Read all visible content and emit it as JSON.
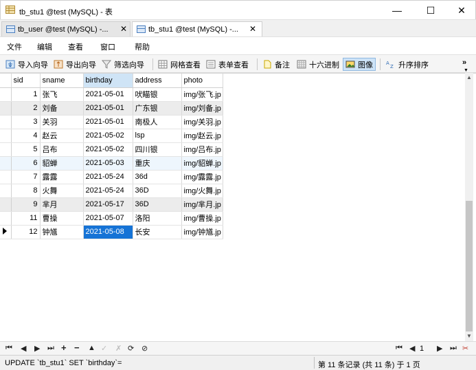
{
  "window": {
    "title": "tb_stu1 @test (MySQL) - 表",
    "controls": {
      "minimize": "—",
      "maximize": "☐",
      "close": "✕"
    }
  },
  "tabs": [
    {
      "label": "tb_user @test (MySQL) -...",
      "close": "✕",
      "active": false
    },
    {
      "label": "tb_stu1 @test (MySQL) -...",
      "close": "✕",
      "active": true
    }
  ],
  "menu": [
    "文件",
    "编辑",
    "查看",
    "窗口",
    "帮助"
  ],
  "toolbar": {
    "import_wizard": "导入向导",
    "export_wizard": "导出向导",
    "filter_wizard": "筛选向导",
    "grid_view": "网格查看",
    "form_view": "表单查看",
    "memo": "备注",
    "hex": "十六进制",
    "image": "图像",
    "sort_asc": "升序排序",
    "more": "»"
  },
  "grid": {
    "columns": [
      "sid",
      "sname",
      "birthday",
      "address",
      "photo"
    ],
    "selected_column": "birthday",
    "rows": [
      {
        "sid": "1",
        "sname": "张飞",
        "birthday": "2021-05-01",
        "address": "吠瞄银",
        "photo": "img/张飞.jp"
      },
      {
        "sid": "2",
        "sname": "刘备",
        "birthday": "2021-05-01",
        "address": "广东银",
        "photo": "img/刘备.jp"
      },
      {
        "sid": "3",
        "sname": "关羽",
        "birthday": "2021-05-01",
        "address": "南极人",
        "photo": "img/关羽.jp"
      },
      {
        "sid": "4",
        "sname": "赵云",
        "birthday": "2021-05-02",
        "address": "lsp",
        "photo": "img/赵云.jp"
      },
      {
        "sid": "5",
        "sname": "吕布",
        "birthday": "2021-05-02",
        "address": "四川银",
        "photo": "img/吕布.jp"
      },
      {
        "sid": "6",
        "sname": "貂蝉",
        "birthday": "2021-05-03",
        "address": "重庆",
        "photo": "img/貂蝉.jp"
      },
      {
        "sid": "7",
        "sname": "露露",
        "birthday": "2021-05-24",
        "address": "36d",
        "photo": "img/露露.jp"
      },
      {
        "sid": "8",
        "sname": "火舞",
        "birthday": "2021-05-24",
        "address": "36D",
        "photo": "img/火舞.jp"
      },
      {
        "sid": "9",
        "sname": "芈月",
        "birthday": "2021-05-17",
        "address": "36D",
        "photo": "img/芈月.jp"
      },
      {
        "sid": "11",
        "sname": "曹操",
        "birthday": "2021-05-07",
        "address": "洛阳",
        "photo": "img/曹操.jp"
      },
      {
        "sid": "12",
        "sname": "钟馗",
        "birthday": "2021-05-08",
        "address": "长安",
        "photo": "img/钟馗.jp"
      }
    ],
    "current_row_index": 10,
    "selected_cell": {
      "row": 10,
      "column": "birthday"
    }
  },
  "navigation": {
    "first": "⏮",
    "prev": "◀",
    "next": "▶",
    "last": "⏭",
    "add": "+",
    "delete": "−",
    "up": "▲",
    "apply": "✓",
    "discard": "✗",
    "refresh": "⟳",
    "stop": "⊘",
    "page_first": "⏮",
    "page_prev": "◀",
    "page_value": "1",
    "page_next": "▶",
    "page_last": "⏭",
    "settings": "✂"
  },
  "status": {
    "sql": "UPDATE `tb_stu1` SET `birthday`=",
    "record": "第 11 条记录 (共 11 条) 于 1 页"
  },
  "colors": {
    "selected_cell": "#1573d6",
    "selected_header": "#cfe4f6",
    "alt_row": "#eef6fd",
    "gray_row": "#ececec"
  }
}
